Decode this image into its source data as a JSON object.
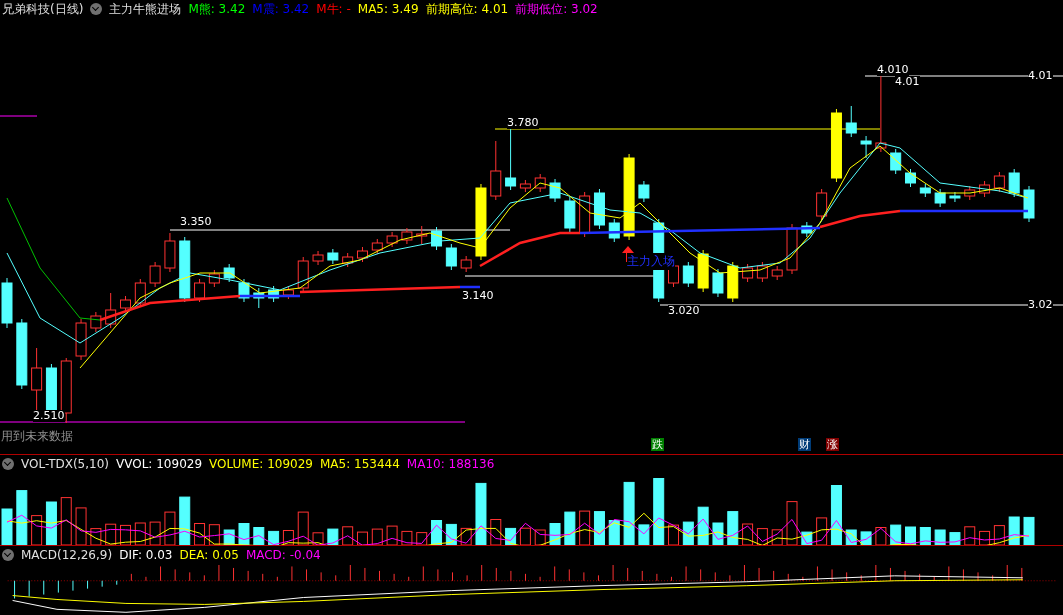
{
  "title_bar": {
    "stock": "兄弟科技(日线)",
    "indicator": "主力牛熊进场",
    "readings": [
      {
        "text": "M熊: 3.42",
        "color": "#00ff00"
      },
      {
        "text": "M震: 3.42",
        "color": "#0000ff"
      },
      {
        "text": "M牛: -",
        "color": "#ff0000"
      },
      {
        "text": "MA5: 3.49",
        "color": "#ffff00"
      },
      {
        "text": "前期高位: 4.01",
        "color": "#ffff00"
      },
      {
        "text": "前期低位: 3.02",
        "color": "#ff00ff"
      }
    ]
  },
  "main_chart": {
    "price_labels": [
      "3.350",
      "3.780",
      "3.140",
      "3.020",
      "4.010",
      "4.01",
      "2.510",
      "4.01",
      "3.02"
    ],
    "signal_label": "主力入场",
    "warning": "用到未来数据",
    "markers": [
      {
        "text": "跌",
        "color": "#008000"
      },
      {
        "text": "财",
        "color": "#003c78"
      },
      {
        "text": "涨",
        "color": "#800000"
      }
    ]
  },
  "volume_panel": {
    "name": "VOL-TDX(5,10)",
    "readings": [
      {
        "text": "VVOL: 109029",
        "color": "#ffffff"
      },
      {
        "text": "VOLUME: 109029",
        "color": "#ffff00"
      },
      {
        "text": "MA5: 153444",
        "color": "#ffff00"
      },
      {
        "text": "MA10: 188136",
        "color": "#ff00ff"
      }
    ]
  },
  "macd_panel": {
    "name": "MACD(12,26,9)",
    "readings": [
      {
        "text": "DIF: 0.03",
        "color": "#ffffff"
      },
      {
        "text": "DEA: 0.05",
        "color": "#ffff00"
      },
      {
        "text": "MACD: -0.04",
        "color": "#ff00ff"
      }
    ]
  }
}
